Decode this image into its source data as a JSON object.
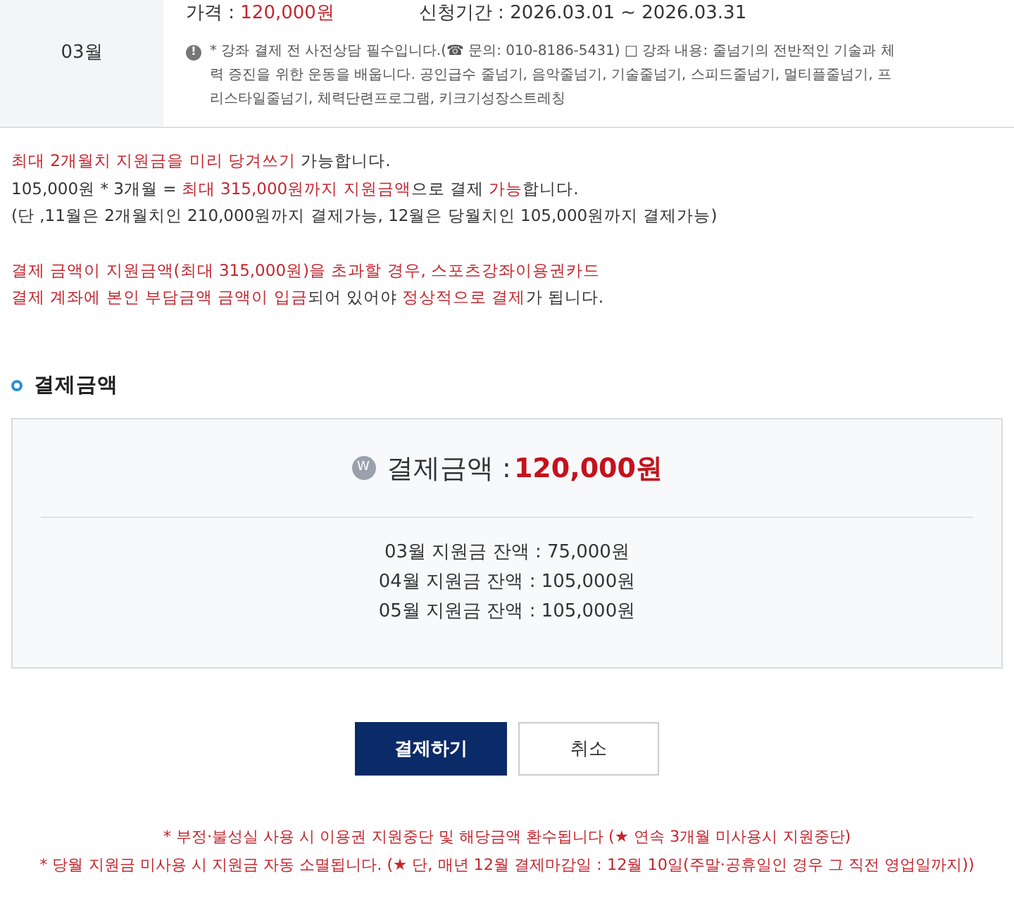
{
  "course_row": {
    "month": "03월",
    "price_label": "가격 : ",
    "price": "120,000원",
    "period": "신청기간 : 2026.03.01 ~ 2026.03.31",
    "info_icon": "!",
    "info": "* 강좌 결제 전 사전상담 필수입니다.(☎ 문의: 010-8186-5431) □ 강좌 내용: 줄넘기의 전반적인 기술과 체력 증진을 위한 운동을 배웁니다. 공인급수 줄넘기, 음악줄넘기, 기술줄넘기, 스피드줄넘기, 멀티플줄넘기, 프리스타일줄넘기, 체력단련프로그램, 키크기성장스트레칭"
  },
  "notices": [
    [
      {
        "text": "최대 2개월치 지원금을 미리 당겨쓰기",
        "highlight": true
      },
      {
        "text": " 가능합니다.",
        "highlight": false
      }
    ],
    [
      {
        "text": "105,000원 * 3개월 = ",
        "highlight": false
      },
      {
        "text": "최대 315,000원까지 지원금액",
        "highlight": true
      },
      {
        "text": "으로 결제 ",
        "highlight": false
      },
      {
        "text": "가능",
        "highlight": true
      },
      {
        "text": "합니다.",
        "highlight": false
      }
    ],
    [
      {
        "text": "(단 ,11월은 2개월치인 210,000원까지 결제가능, 12월은 당월치인 105,000원까지 결제가능)",
        "highlight": false
      }
    ],
    [
      {
        "text": "결제 금액이 지원금액(최대 315,000원)을 초과할 경우, 스포츠강좌이용권카드",
        "highlight": true
      }
    ],
    [
      {
        "text": "결제 계좌에 본인 부담금액 금액이 입금",
        "highlight": true
      },
      {
        "text": "되어 있어야 ",
        "highlight": false
      },
      {
        "text": "정상적으로 결제",
        "highlight": true
      },
      {
        "text": "가 됩니다.",
        "highlight": false
      }
    ]
  ],
  "payment_section": {
    "title": "결제금액",
    "currency_icon": "W",
    "amount_label": "결제금액 :",
    "amount": "120,000원",
    "balances": [
      "03월 지원금 잔액 : 75,000원",
      "04월 지원금 잔액 : 105,000원",
      "05월 지원금 잔액 : 105,000원"
    ]
  },
  "buttons": [
    {
      "label": "결제하기",
      "kind": "primary"
    },
    {
      "label": "취소",
      "kind": "secondary"
    }
  ],
  "footer_notes": [
    "* 부정·불성실 사용 시 이용권 지원중단 및 해당금액 환수됩니다 (★ 연속 3개월 미사용시 지원중단)",
    "* 당월 지원금 미사용 시 지원금 자동 소멸됩니다. (★ 단, 매년 12월 결제마감일 : 12월 10일(주말·공휴일인 경우 그 직전 영업일까지))"
  ]
}
